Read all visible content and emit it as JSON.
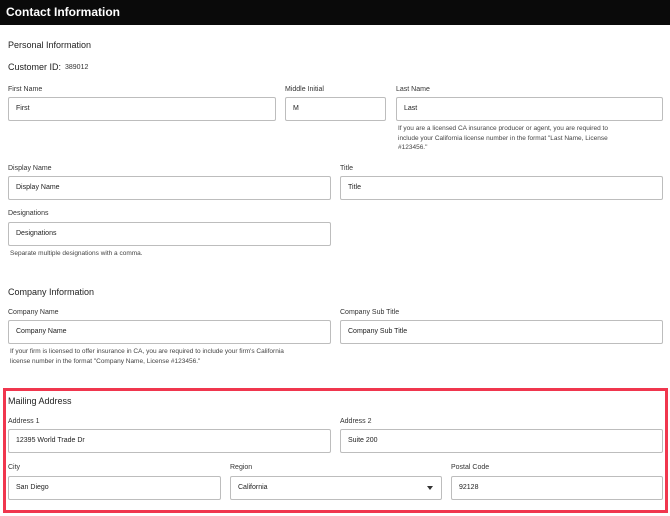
{
  "window": {
    "title": "Contact Information"
  },
  "personal": {
    "section_title": "Personal Information",
    "customer_id_label": "Customer ID:",
    "customer_id_value": "389012",
    "first_name": {
      "label": "First Name",
      "value": "First"
    },
    "middle_initial": {
      "label": "Middle Initial",
      "value": "M"
    },
    "last_name": {
      "label": "Last Name",
      "value": "Last",
      "help_line1": "If you are a licensed CA insurance producer or agent, you are required to",
      "help_line2": "include your California license number in the format \"Last Name, License",
      "help_line3": "#123456.\""
    },
    "display_name": {
      "label": "Display Name",
      "value": "Display Name"
    },
    "title": {
      "label": "Title",
      "value": "Title"
    },
    "designations": {
      "label": "Designations",
      "value": "Designations",
      "help": "Separate multiple designations with a comma."
    }
  },
  "company": {
    "section_title": "Company Information",
    "company_name": {
      "label": "Company Name",
      "value": "Company Name",
      "help_line1": "If your firm is licensed to offer insurance in CA, you are required to include your firm's California",
      "help_line2": "license number in the format \"Company Name, License #123456.\""
    },
    "company_sub_title": {
      "label": "Company Sub Title",
      "value": "Company Sub Title"
    }
  },
  "mailing": {
    "section_title": "Mailing Address",
    "address1": {
      "label": "Address 1",
      "value": "12395 World Trade Dr"
    },
    "address2": {
      "label": "Address 2",
      "value": "Suite 200"
    },
    "city": {
      "label": "City",
      "value": "San Diego"
    },
    "region": {
      "label": "Region",
      "value": "California"
    },
    "postal_code": {
      "label": "Postal Code",
      "value": "92128"
    }
  },
  "colors": {
    "titlebar": "#0a0a0a",
    "highlight": "#f0364e",
    "border": "#bdbdbd"
  },
  "icons": {
    "region_dropdown": "chevron-down-icon"
  }
}
